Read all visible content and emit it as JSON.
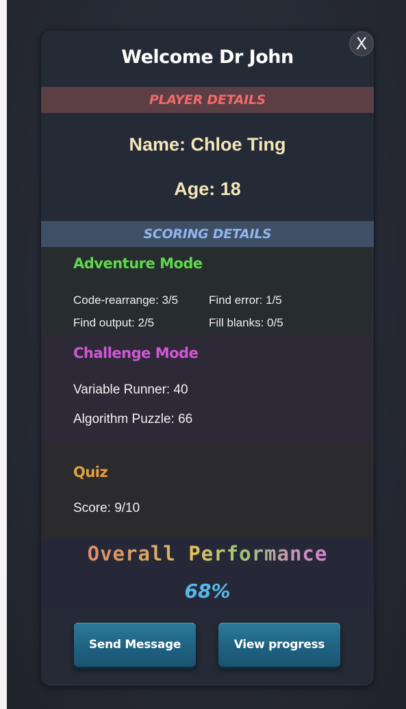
{
  "header": {
    "welcome": "Welcome Dr John",
    "close_label": "X"
  },
  "player_details": {
    "section_label": "PLAYER DETAILS",
    "name": "Name: Chloe Ting",
    "age": "Age: 18"
  },
  "scoring_details": {
    "section_label": "SCORING DETAILS",
    "adventure": {
      "title": "Adventure Mode",
      "code_rearrange": "Code-rearrange: 3/5",
      "find_error": "Find error: 1/5",
      "find_output": "Find output: 2/5",
      "fill_blanks": "Fill blanks: 0/5"
    },
    "challenge": {
      "title": "Challenge Mode",
      "variable_runner": "Variable Runner: 40",
      "algorithm_puzzle": "Algorithm Puzzle: 66"
    },
    "quiz": {
      "title": "Quiz",
      "score": "Score: 9/10"
    }
  },
  "overall": {
    "title": "Overall Performance",
    "value": "68%"
  },
  "actions": {
    "send_message": "Send Message",
    "view_progress": "View progress"
  },
  "colors": {
    "player_bar": "#5c3e45",
    "scoring_bar": "#3e4f66",
    "adventure_title": "#5fd84a",
    "challenge_title": "#d257d6",
    "quiz_title": "#e3a23c",
    "overall_value": "#56b8e6",
    "button": "#1f6282"
  }
}
